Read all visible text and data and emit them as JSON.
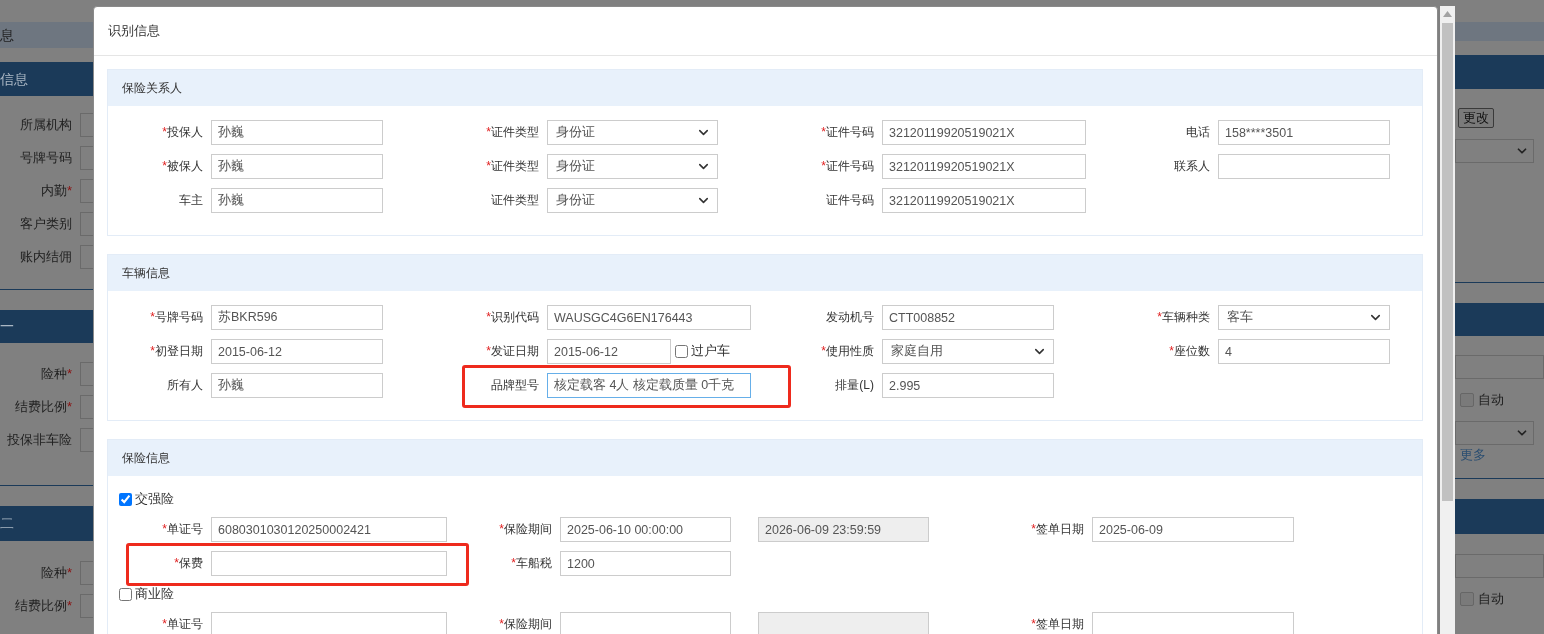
{
  "background": {
    "header": "息",
    "left_groups": [
      {
        "title": "信息",
        "rows": [
          {
            "label": "所属机构"
          },
          {
            "label": "号牌号码"
          },
          {
            "label": "内勤",
            "mark": "*"
          },
          {
            "label": "客户类别"
          },
          {
            "label": "账内结佣"
          }
        ]
      },
      {
        "title": "一",
        "rows": [
          {
            "label": "险种",
            "mark": "*"
          },
          {
            "label": "结费比例",
            "mark": "*"
          },
          {
            "label": "投保非车险"
          }
        ]
      },
      {
        "title": "二",
        "rows": [
          {
            "label": "险种",
            "mark": "*"
          },
          {
            "label": "结费比例",
            "mark": "*"
          }
        ]
      }
    ],
    "right_groups": [
      {
        "items": [
          {
            "kind": "button",
            "text": "更改"
          },
          {
            "kind": "select"
          }
        ]
      },
      {
        "items": [
          {
            "kind": "input"
          },
          {
            "kind": "checkbox",
            "label": "自动",
            "checked": false
          },
          {
            "kind": "select"
          },
          {
            "kind": "link",
            "text": "更多"
          }
        ]
      },
      {
        "items": [
          {
            "kind": "input"
          },
          {
            "kind": "checkbox",
            "label": "自动",
            "checked": false
          }
        ]
      }
    ]
  },
  "dialog": {
    "title": "识别信息",
    "sections": [
      {
        "title": "保险关系人",
        "rows": [
          {
            "fields": [
              {
                "kind": "text",
                "mark": "*",
                "label": "投保人",
                "value": "孙巍"
              },
              {
                "kind": "select",
                "mark": "*",
                "label": "证件类型",
                "value": "身份证"
              },
              {
                "kind": "text",
                "mark": "*",
                "label": "证件号码",
                "value": "32120119920519021X"
              },
              {
                "kind": "text",
                "label": "电话",
                "value": "158****3501"
              }
            ]
          },
          {
            "fields": [
              {
                "kind": "text",
                "mark": "*",
                "label": "被保人",
                "value": "孙巍"
              },
              {
                "kind": "select",
                "mark": "*",
                "label": "证件类型",
                "value": "身份证"
              },
              {
                "kind": "text",
                "mark": "*",
                "label": "证件号码",
                "value": "32120119920519021X"
              },
              {
                "kind": "text",
                "label": "联系人"
              }
            ]
          },
          {
            "fields": [
              {
                "kind": "text",
                "label": "车主",
                "value": "孙巍"
              },
              {
                "kind": "select",
                "label": "证件类型",
                "value": "身份证"
              },
              {
                "kind": "text",
                "label": "证件号码",
                "value": "32120119920519021X"
              }
            ]
          }
        ]
      },
      {
        "title": "车辆信息",
        "rows": [
          {
            "fields": [
              {
                "kind": "text",
                "mark": "*",
                "label": "号牌号码",
                "value": "苏BKR596"
              },
              {
                "kind": "text",
                "mark": "*",
                "label": "识别代码",
                "value": "WAUSGC4G6EN176443"
              },
              {
                "kind": "text",
                "label": "发动机号",
                "value": "CTT008852"
              },
              {
                "kind": "select",
                "mark": "*",
                "label": "车辆种类",
                "value": "客车"
              }
            ]
          },
          {
            "fields": [
              {
                "kind": "text",
                "mark": "*",
                "label": "初登日期",
                "value": "2015-06-12"
              },
              {
                "kind": "text",
                "mark": "*",
                "label": "发证日期",
                "value": "2015-06-12",
                "checkbox": {
                  "label": "过户车",
                  "checked": false
                }
              },
              {
                "kind": "select",
                "mark": "*",
                "label": "使用性质",
                "value": "家庭自用"
              },
              {
                "kind": "text",
                "mark": "*",
                "label": "座位数",
                "value": "4"
              }
            ]
          },
          {
            "fields": [
              {
                "kind": "text",
                "label": "所有人",
                "value": "孙巍"
              },
              {
                "kind": "text",
                "label": "品牌型号",
                "value": "核定载客 4人 核定载质量 0千克",
                "focused": true,
                "highlighted": true
              },
              {
                "kind": "text",
                "label": "排量(L)",
                "value": "2.995"
              }
            ]
          }
        ]
      },
      {
        "title": "保险信息",
        "groups": [
          {
            "checkbox": {
              "label": "交强险",
              "checked": true
            },
            "rows": [
              {
                "fields": [
                  {
                    "kind": "text",
                    "mark": "*",
                    "label": "单证号",
                    "value": "6080301030120250002421"
                  },
                  {
                    "kind": "text",
                    "mark": "*",
                    "label": "保险期间",
                    "value": "2025-06-10 00:00:00"
                  },
                  {
                    "kind": "text",
                    "disabled": true,
                    "value": "2026-06-09 23:59:59"
                  },
                  {
                    "kind": "text",
                    "mark": "*",
                    "label": "签单日期",
                    "value": "2025-06-09"
                  }
                ]
              },
              {
                "fields": [
                  {
                    "kind": "text",
                    "mark": "*",
                    "label": "保费",
                    "highlighted": true
                  },
                  {
                    "kind": "text",
                    "mark": "*",
                    "label": "车船税",
                    "value": "1200"
                  }
                ]
              }
            ]
          },
          {
            "checkbox": {
              "label": "商业险",
              "checked": false
            },
            "rows": [
              {
                "fields": [
                  {
                    "kind": "text",
                    "mark": "*",
                    "label": "单证号"
                  },
                  {
                    "kind": "text",
                    "mark": "*",
                    "label": "保险期间"
                  },
                  {
                    "kind": "text",
                    "disabled": true
                  },
                  {
                    "kind": "text",
                    "mark": "*",
                    "label": "签单日期"
                  }
                ]
              }
            ]
          }
        ]
      }
    ]
  }
}
